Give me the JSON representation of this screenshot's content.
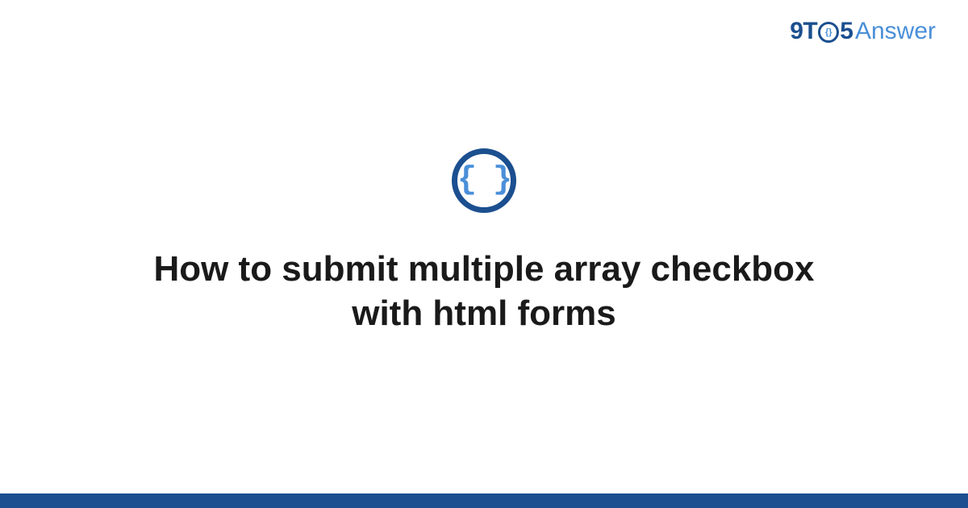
{
  "logo": {
    "part1": "9T",
    "inner": "{}",
    "part2": "5",
    "part3": "Answer"
  },
  "icon": {
    "glyph": "{ }"
  },
  "title": "How to submit multiple array checkbox with html forms",
  "colors": {
    "primary": "#1b4f8f",
    "accent": "#4a8fd8"
  }
}
